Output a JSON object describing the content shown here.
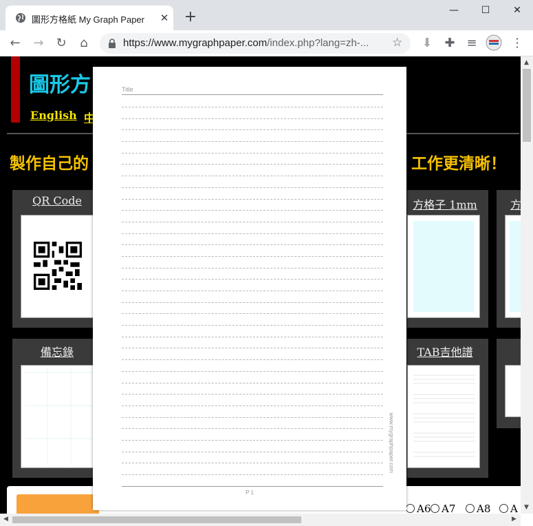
{
  "browser": {
    "tab_title": "圖形方格紙 My Graph Paper",
    "url_host": "https://www.mygraphpaper.com",
    "url_rest": "/index.php?lang=zh-..."
  },
  "site": {
    "title": "圖形方",
    "lang_links": [
      "English",
      "中"
    ],
    "slogan_left": "製作自己的",
    "slogan_right": "工作更清晰！",
    "cards_row1": [
      "QR Code",
      "方格子 1mm",
      "方"
    ],
    "cards_row2": [
      "備忘錄",
      "TAB吉他譜"
    ],
    "paper_sizes": [
      "A6",
      "A7",
      "A8",
      "A"
    ]
  },
  "preview": {
    "title_label": "Title",
    "page_label": "P 1",
    "watermark": "www.mygraphpaper.com",
    "line_count": 33
  },
  "colors": {
    "accent_cyan": "#19c9e8",
    "accent_yellow": "#f5e400",
    "slogan": "#f5c100",
    "red_bar": "#b20000",
    "orange_button": "#f8a23c"
  }
}
